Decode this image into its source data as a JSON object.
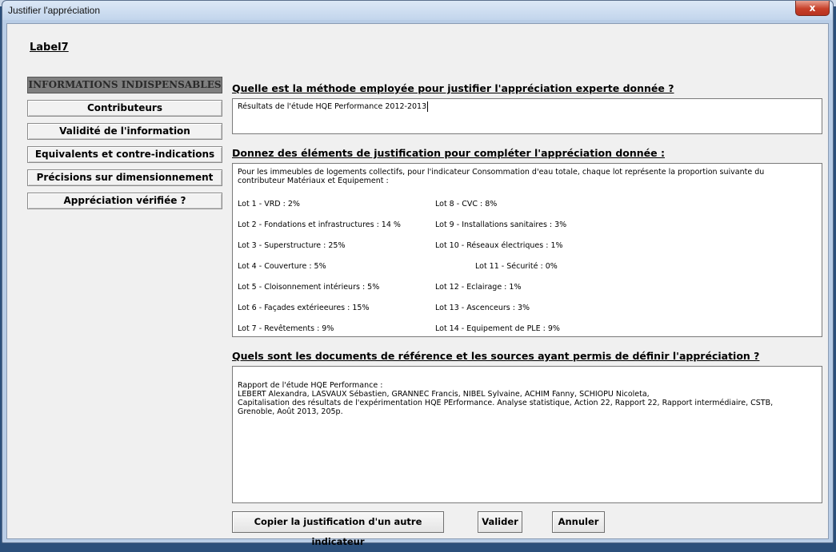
{
  "window": {
    "title": "Justifier l'appréciation",
    "close_glyph": "x"
  },
  "label7": "Label7",
  "nav": [
    {
      "label": "INFORMATIONS INDISPENSABLES",
      "active": true
    },
    {
      "label": "Contributeurs"
    },
    {
      "label": "Validité de l'information"
    },
    {
      "label": "Equivalents et contre-indications"
    },
    {
      "label": "Précisions sur dimensionnement"
    },
    {
      "label": "Appréciation vérifiée ?"
    }
  ],
  "q1": {
    "label": "Quelle est la méthode employée pour justifier l'appréciation experte donnée ?",
    "value": "Résultats de l'étude HQE Performance 2012-2013"
  },
  "q2": {
    "label": "Donnez des éléments de justification pour compléter l'appréciation donnée :",
    "intro": "Pour les immeubles de logements collectifs, pour l'indicateur Consommation d'eau totale, chaque lot représente la proportion suivante du contributeur Matériaux et Equipement :",
    "lots_left": [
      "Lot 1 - VRD : 2%",
      "Lot 2 - Fondations et infrastructures : 14 %",
      "Lot 3 - Superstructure : 25%",
      "Lot 4 - Couverture : 5%",
      "Lot 5 - Cloisonnement intérieurs : 5%",
      "Lot 6 - Façades extérieeures : 15%",
      "Lot 7 - Revêtements : 9%"
    ],
    "lots_right": [
      "Lot 8 - CVC : 8%",
      "Lot 9 - Installations sanitaires : 3%",
      "Lot 10 - Réseaux électriques : 1%",
      "Lot 11 - Sécurité : 0%",
      "Lot 12 - Eclairage : 1%",
      "Lot 13 - Ascenceurs : 3%",
      "Lot 14 - Equipement de PLE : 9%"
    ]
  },
  "q3": {
    "label": "Quels sont les documents de référence et les sources ayant permis de définir l'appréciation ?",
    "lines": [
      "Rapport de l'étude HQE Performance :",
      "LEBERT Alexandra, LASVAUX Sébastien, GRANNEC Francis, NIBEL Sylvaine, ACHIM Fanny, SCHIOPU Nicoleta,",
      "Capitalisation des résultats de l'expérimentation HQE PErformance. Analyse statistique, Action 22, Rapport 22, Rapport intermédiaire, CSTB,",
      "Grenoble, Août 2013, 205p."
    ]
  },
  "buttons": {
    "copy": "Copier la justification d'un autre indicateur",
    "validate": "Valider",
    "cancel": "Annuler"
  }
}
